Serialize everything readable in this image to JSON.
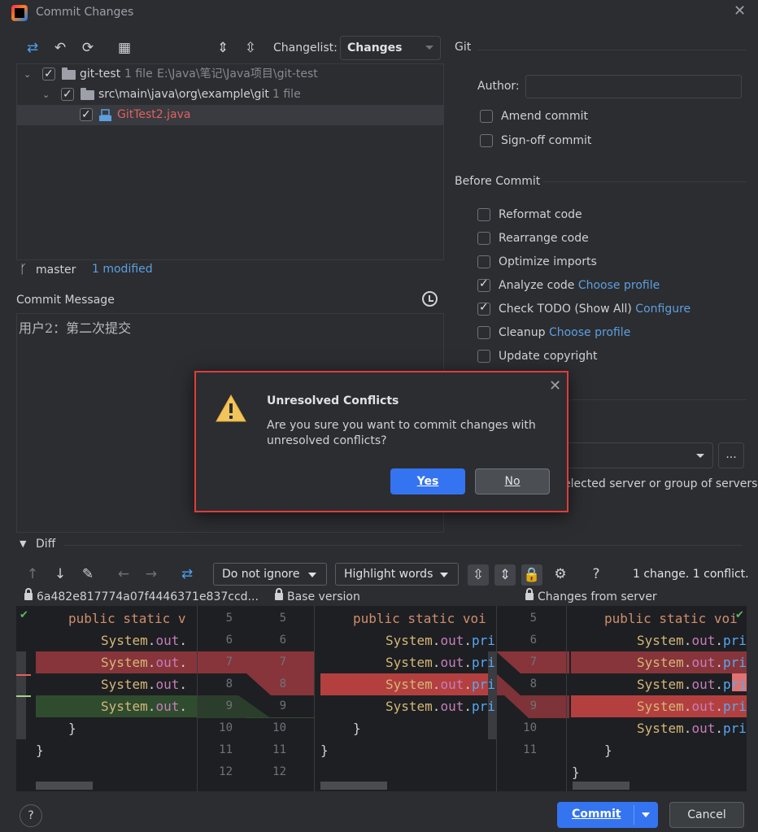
{
  "window": {
    "title": "Commit Changes"
  },
  "toolbar": {
    "changelist_label": "Changelist:",
    "changelist_value": "Changes"
  },
  "tree": {
    "root": {
      "name": "git-test",
      "count": "1 file",
      "path": "E:\\Java\\笔记\\Java项目\\git-test"
    },
    "folder": {
      "name": "src\\main\\java\\org\\example\\git",
      "count": "1 file"
    },
    "file": {
      "name": "GitTest2.java"
    }
  },
  "status": {
    "branch": "master",
    "modified": "1 modified"
  },
  "commit_message": {
    "label": "Commit Message",
    "text": "用户2：第二次提交"
  },
  "git_panel": {
    "title": "Git",
    "author_label": "Author:",
    "amend": "Amend commit",
    "signoff": "Sign-off commit"
  },
  "before_commit": {
    "title": "Before Commit",
    "options": [
      {
        "label": "Reformat code",
        "checked": false,
        "link": ""
      },
      {
        "label": "Rearrange code",
        "checked": false,
        "link": ""
      },
      {
        "label": "Optimize imports",
        "checked": false,
        "link": ""
      },
      {
        "label": "Analyze code",
        "checked": true,
        "link": "Choose profile"
      },
      {
        "label": "Check TODO (Show All)",
        "checked": true,
        "link": "Configure"
      },
      {
        "label": "Cleanup",
        "checked": false,
        "link": "Choose profile"
      },
      {
        "label": "Update copyright",
        "checked": false,
        "link": ""
      }
    ]
  },
  "server": {
    "more": "...",
    "text": "elected server or group of servers"
  },
  "diff": {
    "label": "Diff",
    "ignore": "Do not ignore",
    "highlight": "Highlight words",
    "summary": "1 change. 1 conflict.",
    "left_header": "6a482e817774a07f4446371e837ccd...",
    "middle_header": "Base version",
    "right_header": "Changes from server",
    "line_numbers": [
      "5",
      "6",
      "7",
      "8",
      "9",
      "10",
      "11",
      "12"
    ],
    "code": {
      "sig_left": "public static v",
      "sig_mid": "public static voi",
      "sig_right": "public static voi",
      "sys": "System",
      "out": "out",
      "dot": ".",
      "pri_mid": "pri",
      "pri_right": "pri",
      "brace": "}"
    }
  },
  "footer": {
    "help": "?",
    "commit": "Commit",
    "cancel": "Cancel"
  },
  "modal": {
    "title": "Unresolved Conflicts",
    "message": "Are you sure you want to commit changes with unresolved conflicts?",
    "yes": "Yes",
    "no": "No"
  }
}
